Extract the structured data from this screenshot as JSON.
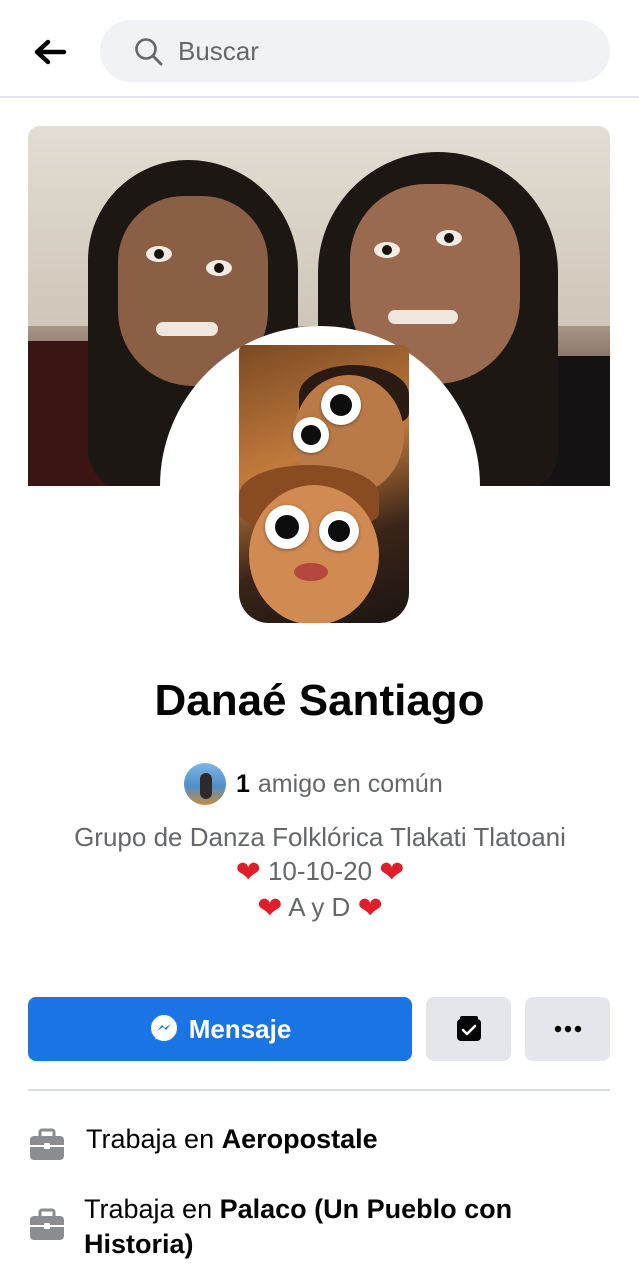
{
  "search": {
    "placeholder": "Buscar"
  },
  "profile": {
    "name": "Danaé Santiago",
    "mutual_count": "1",
    "mutual_text": "amigo en común",
    "bio_line1": "Grupo de Danza Folklórica Tlakati Tlatoani",
    "bio_line2": "10-10-20",
    "bio_line3": "A y D"
  },
  "actions": {
    "message_label": "Mensaje"
  },
  "work": [
    {
      "prefix": "Trabaja en",
      "place": "Aeropostale"
    },
    {
      "prefix": "Trabaja en",
      "place": "Palaco (Un Pueblo con Historia)"
    }
  ],
  "colors": {
    "primary": "#1b74e4",
    "secondary_button": "#e4e6eb",
    "heart": "#e01e2b",
    "muted_text": "#65676b"
  },
  "icons": [
    "back-arrow-icon",
    "search-icon",
    "messenger-icon",
    "save-profile-icon",
    "more-icon",
    "briefcase-icon"
  ]
}
